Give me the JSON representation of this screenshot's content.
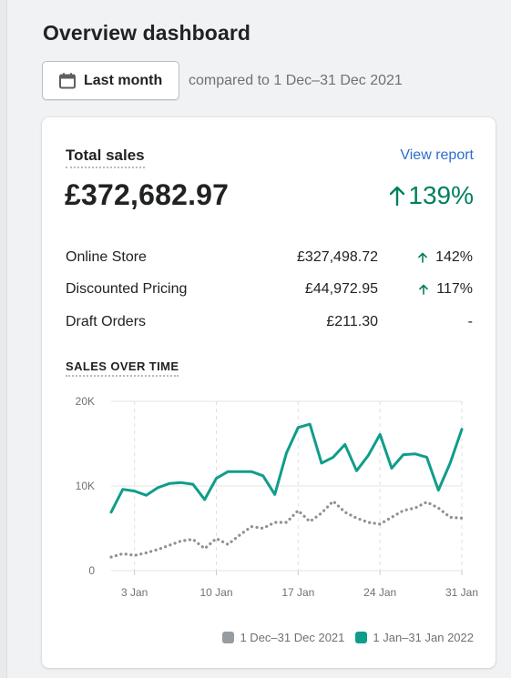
{
  "page": {
    "title": "Overview dashboard"
  },
  "date_filter": {
    "button_label": "Last month",
    "compare_text": "compared to 1 Dec–31 Dec 2021"
  },
  "card": {
    "total_label": "Total sales",
    "view_report": "View report",
    "total_value": "£372,682.97",
    "total_change": "139%",
    "breakdown": [
      {
        "name": "Online Store",
        "value": "£327,498.72",
        "change": "142%",
        "trend": "up"
      },
      {
        "name": "Discounted Pricing",
        "value": "£44,972.95",
        "change": "117%",
        "trend": "up"
      },
      {
        "name": "Draft Orders",
        "value": "£211.30",
        "change": "-",
        "trend": "none"
      }
    ],
    "section_label": "SALES OVER TIME"
  },
  "colors": {
    "current": "#0f9d8b",
    "previous": "#8c9196",
    "positive": "#007f5f",
    "link": "#2c6ecb"
  },
  "chart_data": {
    "type": "line",
    "yticks": [
      "20K",
      "10K",
      "0"
    ],
    "ylim": [
      0,
      20000
    ],
    "xticks": [
      {
        "day": 3,
        "label": "3 Jan"
      },
      {
        "day": 10,
        "label": "10 Jan"
      },
      {
        "day": 17,
        "label": "17 Jan"
      },
      {
        "day": 24,
        "label": "24 Jan"
      },
      {
        "day": 31,
        "label": "31 Jan"
      }
    ],
    "x": [
      1,
      2,
      3,
      4,
      5,
      6,
      7,
      8,
      9,
      10,
      11,
      12,
      13,
      14,
      15,
      16,
      17,
      18,
      19,
      20,
      21,
      22,
      23,
      24,
      25,
      26,
      27,
      28,
      29,
      30,
      31
    ],
    "series": [
      {
        "name": "1 Dec–31 Dec 2021",
        "style": "dotted",
        "color": "#8c9196",
        "values": [
          1600,
          2000,
          1800,
          2100,
          2500,
          3000,
          3500,
          3700,
          2600,
          3800,
          3100,
          4200,
          5200,
          5000,
          5700,
          5700,
          7100,
          5800,
          6800,
          8200,
          6900,
          6200,
          5700,
          5500,
          6300,
          7100,
          7400,
          8100,
          7400,
          6300,
          6200
        ]
      },
      {
        "name": "1 Jan–31 Jan 2022",
        "style": "solid",
        "color": "#0f9d8b",
        "values": [
          6900,
          9600,
          9400,
          8900,
          9800,
          10300,
          10400,
          10200,
          8400,
          10900,
          11700,
          11700,
          11700,
          11200,
          9000,
          13900,
          16900,
          17300,
          12700,
          13400,
          14900,
          11800,
          13600,
          16100,
          12100,
          13700,
          13800,
          13400,
          9500,
          12700,
          16700
        ]
      }
    ]
  }
}
